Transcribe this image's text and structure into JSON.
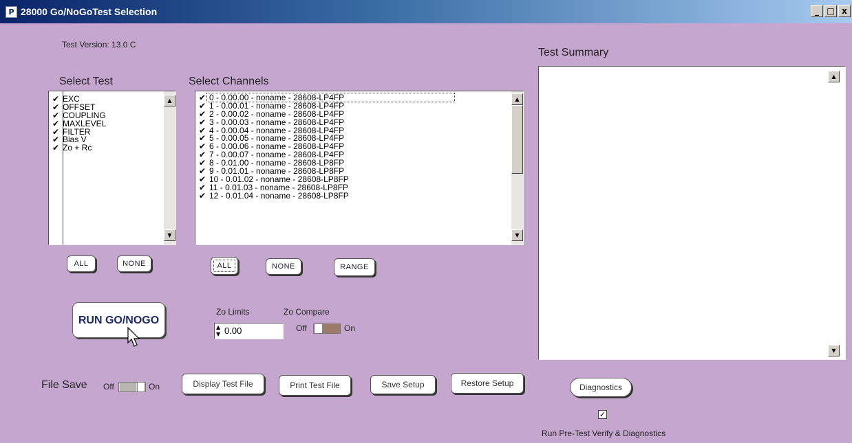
{
  "window": {
    "title": "28000 Go/NoGoTest Selection",
    "app_icon": "P",
    "controls": {
      "minimize": "_",
      "maximize": "□",
      "close": "x"
    }
  },
  "test_version": "Test Version: 13.0 C",
  "select_test": {
    "label": "Select Test",
    "items": [
      {
        "label": "EXC",
        "checked": true
      },
      {
        "label": "OFFSET",
        "checked": true
      },
      {
        "label": "COUPLING",
        "checked": true
      },
      {
        "label": "MAXLEVEL",
        "checked": true
      },
      {
        "label": "FILTER",
        "checked": true
      },
      {
        "label": "Bias V",
        "checked": true
      },
      {
        "label": "Zo + Rc",
        "checked": true
      }
    ],
    "all_button": "ALL",
    "none_button": "NONE"
  },
  "select_channels": {
    "label": "Select Channels",
    "items": [
      {
        "label": "0 - 0.00.00 - noname - 28608-LP4FP",
        "checked": true
      },
      {
        "label": "1 - 0.00.01 - noname - 28608-LP4FP",
        "checked": true
      },
      {
        "label": "2 - 0.00.02 - noname - 28608-LP4FP",
        "checked": true
      },
      {
        "label": "3 - 0.00.03 - noname - 28608-LP4FP",
        "checked": true
      },
      {
        "label": "4 - 0.00.04 - noname - 28608-LP4FP",
        "checked": true
      },
      {
        "label": "5 - 0.00.05 - noname - 28608-LP4FP",
        "checked": true
      },
      {
        "label": "6 - 0.00.06 - noname - 28608-LP4FP",
        "checked": true
      },
      {
        "label": "7 - 0.00.07 - noname - 28608-LP4FP",
        "checked": true
      },
      {
        "label": "8 - 0.01.00 - noname - 28608-LP8FP",
        "checked": true
      },
      {
        "label": "9 - 0.01.01 - noname - 28608-LP8FP",
        "checked": true
      },
      {
        "label": "10 - 0.01.02 - noname - 28608-LP8FP",
        "checked": true
      },
      {
        "label": "11 - 0.01.03 - noname - 28608-LP8FP",
        "checked": true
      },
      {
        "label": "12 - 0.01.04 - noname - 28608-LP8FP",
        "checked": true
      }
    ],
    "all_button": "ALL",
    "none_button": "NONE",
    "range_button": "RANGE"
  },
  "run_button": "RUN GO/NOGO",
  "zo_limits": {
    "label": "Zo Limits",
    "value": "0.00"
  },
  "zo_compare": {
    "label": "Zo Compare",
    "off": "Off",
    "on": "On",
    "state": "on"
  },
  "file_save": {
    "label": "File Save",
    "off": "Off",
    "on": "On",
    "state": "off"
  },
  "buttons": {
    "display_test_file": "Display Test File",
    "print_test_file": "Print Test File",
    "save_setup": "Save Setup",
    "restore_setup": "Restore Setup",
    "diagnostics": "Diagnostics"
  },
  "test_summary": {
    "label": "Test Summary"
  },
  "pretest": {
    "label": "Run Pre-Test Verify & Diagnostics",
    "checked": true
  },
  "icons": {
    "check": "✔",
    "scroll_up": "▲",
    "scroll_down": "▼",
    "spin_up": "▲",
    "spin_down": "▼",
    "checkbox_mark": "✓"
  },
  "colors": {
    "background": "#c5a6cf",
    "titlebar_start": "#0a246a",
    "run_text": "#1b2a6a",
    "toggle_on": "#9b7b6a"
  }
}
